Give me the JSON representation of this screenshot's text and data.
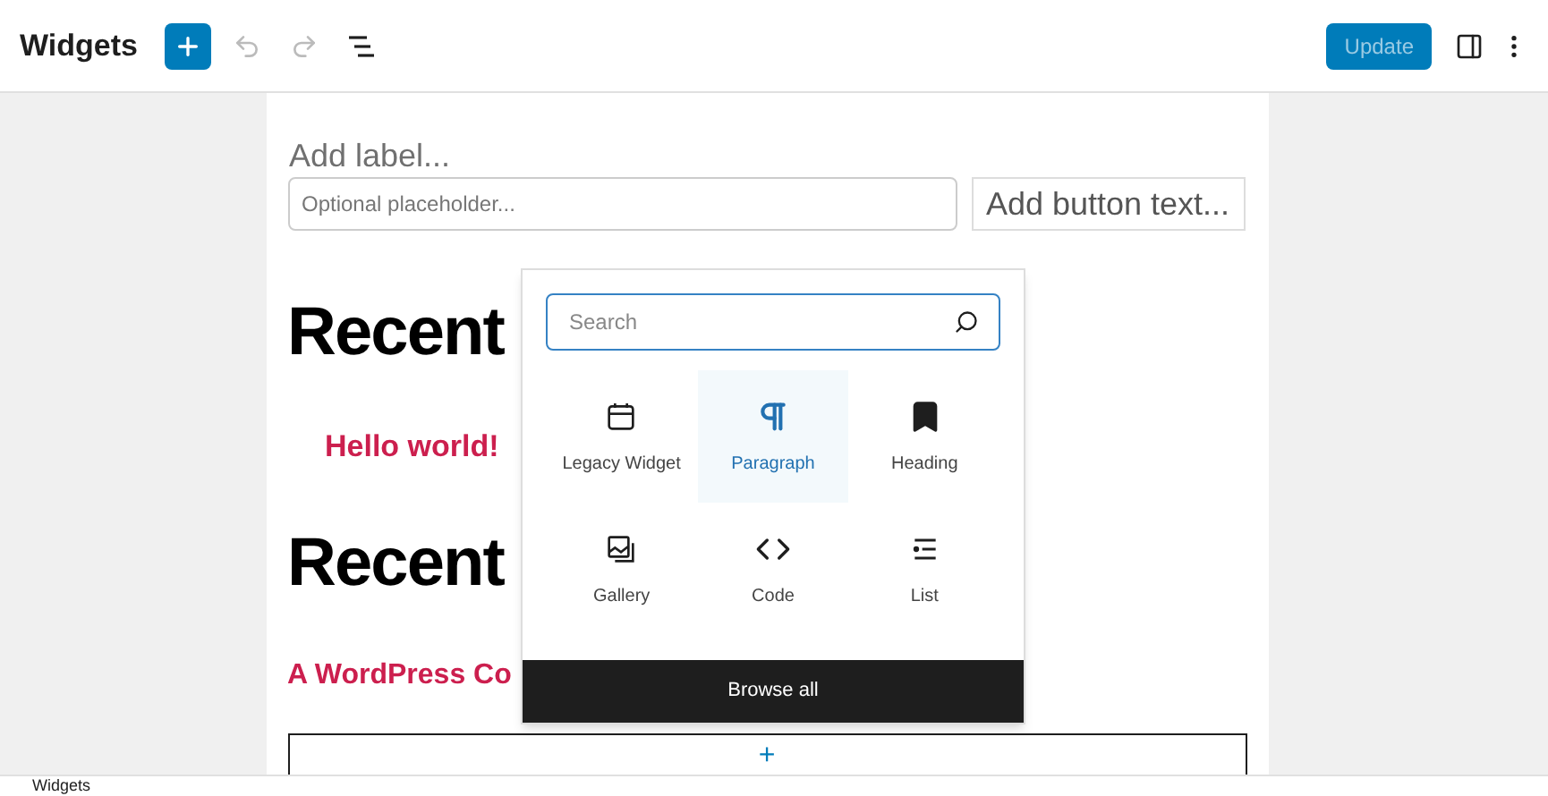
{
  "header": {
    "title": "Widgets",
    "update_button": "Update"
  },
  "form": {
    "label": "Add label...",
    "input_placeholder": "Optional placeholder...",
    "button_text": "Add button text..."
  },
  "blocks": [
    {
      "kind": "heading",
      "text": "Recent"
    },
    {
      "kind": "list-link",
      "text": "Hello world!"
    },
    {
      "kind": "heading",
      "text": "Recent"
    },
    {
      "kind": "link",
      "text": "A WordPress Co"
    }
  ],
  "appender": "+",
  "inserter": {
    "search_placeholder": "Search",
    "items": [
      {
        "label": "Legacy Widget",
        "selected": false
      },
      {
        "label": "Paragraph",
        "selected": true
      },
      {
        "label": "Heading",
        "selected": false
      },
      {
        "label": "Gallery",
        "selected": false
      },
      {
        "label": "Code",
        "selected": false
      },
      {
        "label": "List",
        "selected": false
      }
    ],
    "browse_all": "Browse all"
  },
  "footer": {
    "breadcrumb": "Widgets"
  }
}
